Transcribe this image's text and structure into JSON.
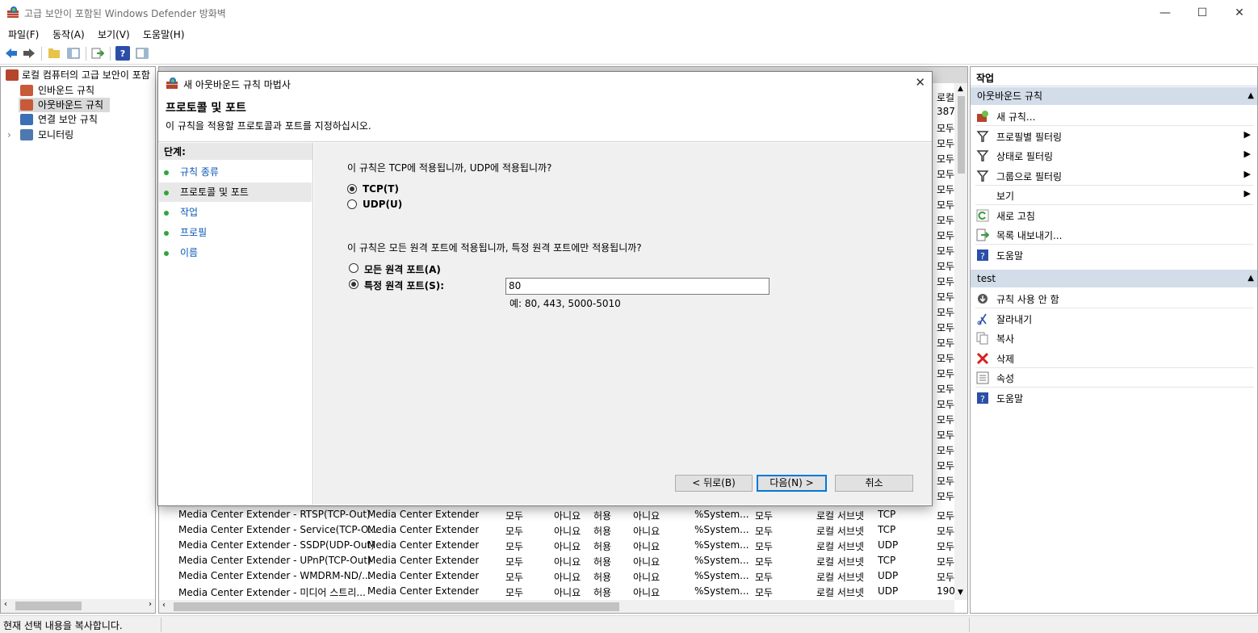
{
  "window": {
    "title": "고급 보안이 포함된 Windows Defender 방화벽",
    "minimize_glyph": "—",
    "maximize_glyph": "☐",
    "close_glyph": "✕"
  },
  "menu": [
    "파일(F)",
    "동작(A)",
    "보기(V)",
    "도움말(H)"
  ],
  "tree": {
    "root": "로컬 컴퓨터의 고급 보안이 포함",
    "items": [
      "인바운드 규칙",
      "아웃바운드 규칙",
      "연결 보안 규칙",
      "모니터링"
    ],
    "expander": "›"
  },
  "list": {
    "right_col_values": [
      "로컬",
      "387",
      "모두",
      "모두",
      "모두",
      "모두",
      "모두",
      "모두",
      "모두",
      "모두",
      "모두",
      "모두",
      "모두",
      "모두",
      "모두",
      "모두",
      "모두",
      "모두",
      "모두",
      "모두",
      "모두",
      "모두",
      "모두",
      "모두",
      "모두",
      "모두",
      "모두"
    ],
    "rows": [
      [
        "Media Center Extender - RTSP(TCP-Out)",
        "Media Center Extender",
        "모두",
        "아니요",
        "허용",
        "아니요",
        "%System...",
        "모두",
        "로컬 서브넷",
        "TCP",
        "모두"
      ],
      [
        "Media Center Extender - Service(TCP-O...",
        "Media Center Extender",
        "모두",
        "아니요",
        "허용",
        "아니요",
        "%System...",
        "모두",
        "로컬 서브넷",
        "TCP",
        "모두"
      ],
      [
        "Media Center Extender - SSDP(UDP-Out)",
        "Media Center Extender",
        "모두",
        "아니요",
        "허용",
        "아니요",
        "%System...",
        "모두",
        "로컬 서브넷",
        "UDP",
        "모두"
      ],
      [
        "Media Center Extender - UPnP(TCP-Out)",
        "Media Center Extender",
        "모두",
        "아니요",
        "허용",
        "아니요",
        "%System...",
        "모두",
        "로컬 서브넷",
        "TCP",
        "모두"
      ],
      [
        "Media Center Extender - WMDRM-ND/...",
        "Media Center Extender",
        "모두",
        "아니요",
        "허용",
        "아니요",
        "%System...",
        "모두",
        "로컬 서브넷",
        "UDP",
        "모두"
      ],
      [
        "Media Center Extender - 미디어 스트리...",
        "Media Center Extender",
        "모두",
        "아니요",
        "허용",
        "아니요",
        "%System...",
        "모두",
        "로컬 서브넷",
        "UDP",
        "190"
      ]
    ]
  },
  "actions": {
    "header": "작업",
    "section1": "아웃바운드 규칙",
    "section1_items": [
      {
        "label": "새 규칙...",
        "icon": "new-rule-icon",
        "arrow": false
      },
      {
        "label": "프로필별 필터링",
        "icon": "filter-icon",
        "arrow": true
      },
      {
        "label": "상태로 필터링",
        "icon": "filter-icon",
        "arrow": true
      },
      {
        "label": "그룹으로 필터링",
        "icon": "filter-icon",
        "arrow": true
      },
      {
        "label": "보기",
        "icon": "",
        "arrow": true
      },
      {
        "label": "새로 고침",
        "icon": "refresh-icon",
        "arrow": false
      },
      {
        "label": "목록 내보내기...",
        "icon": "export-icon",
        "arrow": false
      },
      {
        "label": "도움말",
        "icon": "help-icon",
        "arrow": false
      }
    ],
    "section2": "test",
    "section2_items": [
      {
        "label": "규칙 사용 안 함",
        "icon": "disable-icon"
      },
      {
        "label": "잘라내기",
        "icon": "cut-icon"
      },
      {
        "label": "복사",
        "icon": "copy-icon"
      },
      {
        "label": "삭제",
        "icon": "delete-icon"
      },
      {
        "label": "속성",
        "icon": "properties-icon"
      },
      {
        "label": "도움말",
        "icon": "help-icon"
      }
    ],
    "collapse_glyph": "▲",
    "arrow_glyph": "▶"
  },
  "status": "현재 선택 내용을 복사합니다.",
  "dialog": {
    "title": "새 아웃바운드 규칙 마법사",
    "heading": "프로토콜 및 포트",
    "subtitle": "이 규칙을 적용할 프로토콜과 포트를 지정하십시오.",
    "steps_label": "단계:",
    "steps": [
      "규칙 종류",
      "프로토콜 및 포트",
      "작업",
      "프로필",
      "이름"
    ],
    "q1": "이 규칙은 TCP에 적용됩니까, UDP에 적용됩니까?",
    "tcp": "TCP(T)",
    "udp": "UDP(U)",
    "q2": "이 규칙은 모든 원격 포트에 적용됩니까, 특정 원격 포트에만 적용됩니까?",
    "all_ports": "모든 원격 포트(A)",
    "specific_ports": "특정 원격 포트(S):",
    "port_value": "80",
    "port_example": "예: 80, 443, 5000-5010",
    "back": "< 뒤로(B)",
    "next": "다음(N) >",
    "cancel": "취소",
    "close_glyph": "✕"
  }
}
